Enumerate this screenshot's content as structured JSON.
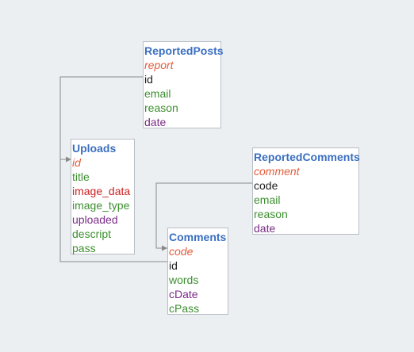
{
  "tables": {
    "reported_posts": {
      "title": "ReportedPosts",
      "fields": [
        "report",
        "id",
        "email",
        "reason",
        "date"
      ]
    },
    "uploads": {
      "title": "Uploads",
      "fields": [
        "id",
        "title",
        "image_data",
        "image_type",
        "uploaded",
        "descript",
        "pass"
      ]
    },
    "reported_comments": {
      "title": "ReportedComments",
      "fields": [
        "comment",
        "code",
        "email",
        "reason",
        "date"
      ]
    },
    "comments": {
      "title": "Comments",
      "fields": [
        "code",
        "id",
        "words",
        "cDate",
        "cPass"
      ]
    }
  },
  "colors": {
    "background": "#eceff2",
    "title": "#3a6fc0",
    "primary_key": "#e25c3c",
    "reference": "#1e1e1e",
    "text_field": "#3c8f2f",
    "date_field": "#7a2b86",
    "blob_field": "#cc2222",
    "connector": "#8a8a8a"
  }
}
